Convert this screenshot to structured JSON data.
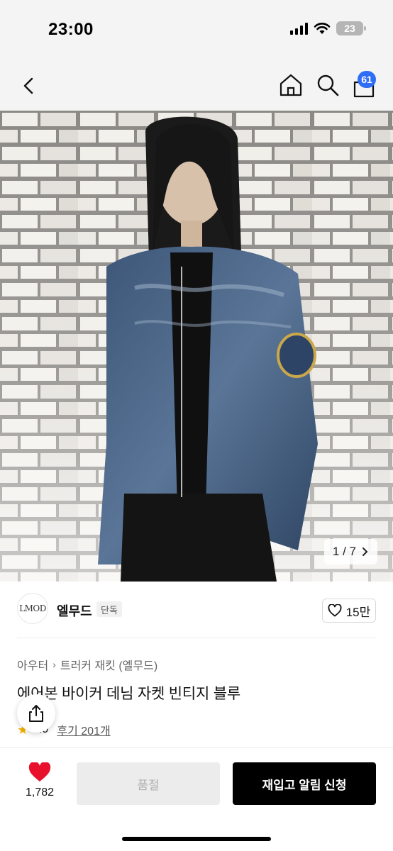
{
  "status_bar": {
    "time": "23:00",
    "battery": "23"
  },
  "header": {
    "cart_count": "61"
  },
  "gallery": {
    "indicator": "1 / 7"
  },
  "brand": {
    "logo_text": "LMOD",
    "name": "엘무드",
    "tag": "단독",
    "likes": "15만"
  },
  "product": {
    "breadcrumb": [
      "아우터",
      "트러커 재킷 (엘무드)"
    ],
    "title": "에어본 바이커 데님 자켓 빈티지 블루",
    "rating": "4.9",
    "reviews": "후기 201개"
  },
  "bottom_bar": {
    "wish_count": "1,782",
    "soldout_label": "품절",
    "restock_label": "재입고 알림 신청"
  },
  "colors": {
    "accent": "#2f6df6",
    "heart": "#e8112d",
    "star": "#f5b400",
    "cta": "#000000"
  }
}
